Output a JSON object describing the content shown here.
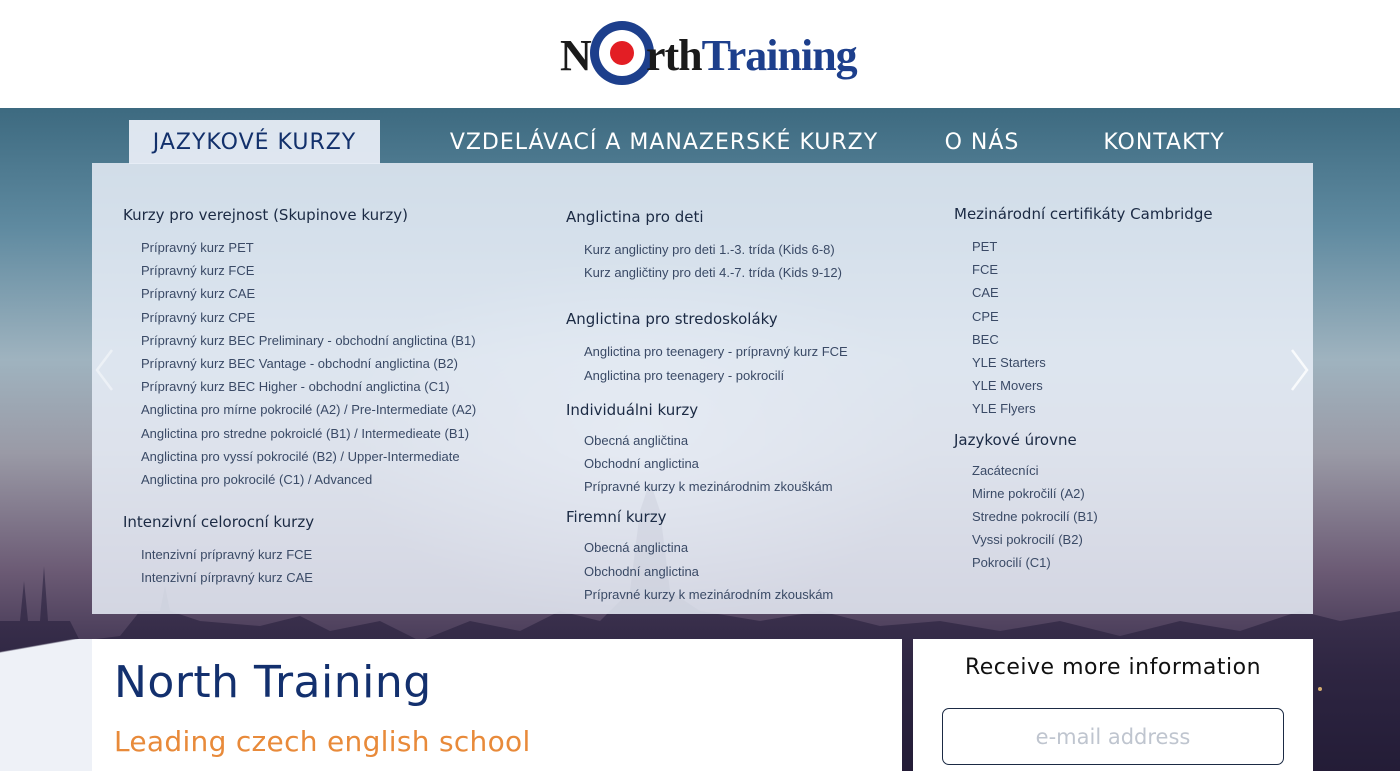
{
  "brand": {
    "logo_n": "N",
    "logo_rest": "rth",
    "logo_training": "Training"
  },
  "nav": {
    "items": [
      {
        "label": "JAZYKOVÉ KURZY"
      },
      {
        "label": "VZDELÁVACÍ A MANAZERSKÉ KURZY"
      },
      {
        "label": "O NÁS"
      },
      {
        "label": "KONTAKTY"
      }
    ]
  },
  "menu": {
    "col1": {
      "g1": {
        "title": "Kurzy pro verejnost (Skupinove kurzy)",
        "links": [
          "Prípravný kurz PET",
          "Prípravný kurz FCE",
          "Prípravný kurz CAE",
          "Prípravný kurz CPE",
          "Prípravný kurz BEC Preliminary - obchodní anglictina (B1)",
          "Prípravný kurz BEC Vantage - obchodní anglictina (B2)",
          "Prípravný kurz BEC Higher - obchodní anglictina (C1)",
          "Anglictina pro mírne pokrocilé (A2) / Pre-Intermediate (A2)",
          "Anglictina pro stredne pokroiclé (B1) / Intermedieate (B1)",
          "Anglictina pro vyssí pokrocilé (B2) / Upper-Intermediate",
          "Anglictina pro pokrocilé (C1) / Advanced"
        ]
      },
      "g2": {
        "title": "Intenzivní celorocní kurzy",
        "links": [
          "Intenzivní prípravný kurz FCE",
          "Intenzivní pírpravný kurz CAE"
        ]
      }
    },
    "col2": {
      "g1": {
        "title": "Anglictina pro deti",
        "links": [
          "Kurz anglictiny pro deti 1.-3. trída (Kids 6-8)",
          "Kurz angličtiny pro deti 4.-7. trída (Kids 9-12)"
        ]
      },
      "g2": {
        "title": "Anglictina pro stredoskoláky",
        "links": [
          "Anglictina pro teenagery - prípravný kurz FCE",
          "Anglictina pro teenagery - pokrocilí"
        ]
      },
      "g3": {
        "title": "Individuálni kurzy",
        "links": [
          "Obecná angličtina",
          "Obchodní anglictina",
          "Prípravné kurzy k mezinárodnim zkouškám"
        ]
      },
      "g4": {
        "title": "Firemní kurzy",
        "links": [
          "Obecná anglictina",
          "Obchodní anglictina",
          "Prípravné kurzy k mezinárodním zkouskám"
        ]
      }
    },
    "col3": {
      "g1": {
        "title": "Mezinárodní certifikáty Cambridge",
        "links": [
          "PET",
          "FCE",
          "CAE",
          "CPE",
          "BEC",
          "YLE Starters",
          "YLE Movers",
          "YLE Flyers"
        ]
      },
      "g2": {
        "title": "Jazykové úrovne",
        "links": [
          "Zacátecníci",
          "Mirne pokročilí (A2)",
          "Stredne pokrocilí (B1)",
          "Vyssi pokrocilí (B2)",
          "Pokrocilí (C1)"
        ]
      }
    }
  },
  "hero": {
    "title": "North Training",
    "subtitle": "Leading czech english school"
  },
  "signup": {
    "title": "Receive more information",
    "email_placeholder": "e-mail address"
  },
  "colors": {
    "navy": "#13306e",
    "orange": "#e88a3a",
    "roundel_red": "#e31e24",
    "roundel_blue": "#1d3f8c"
  }
}
